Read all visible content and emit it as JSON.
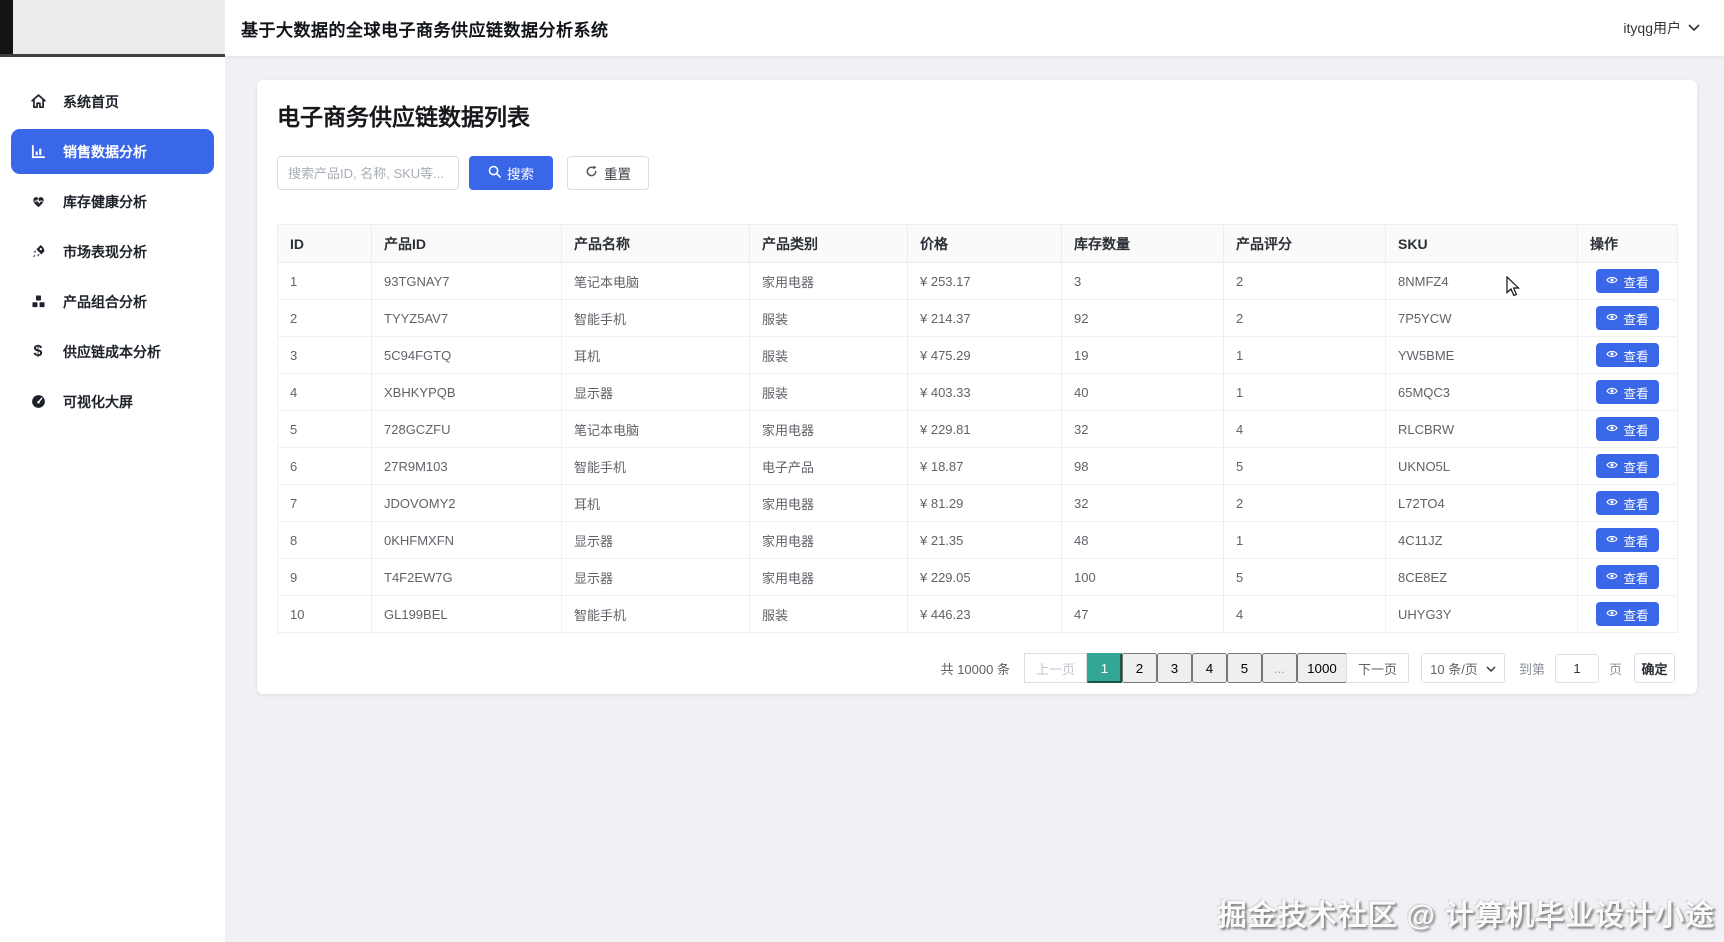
{
  "header": {
    "title": "基于大数据的全球电子商务供应链数据分析系统",
    "user_label": "ityqg用户"
  },
  "sidebar": {
    "items": [
      {
        "label": "系统首页",
        "icon": "home-icon",
        "active": false
      },
      {
        "label": "销售数据分析",
        "icon": "bar-chart-icon",
        "active": true
      },
      {
        "label": "库存健康分析",
        "icon": "heart-pulse-icon",
        "active": false
      },
      {
        "label": "市场表现分析",
        "icon": "rocket-icon",
        "active": false
      },
      {
        "label": "产品组合分析",
        "icon": "boxes-icon",
        "active": false
      },
      {
        "label": "供应链成本分析",
        "icon": "dollar-icon",
        "active": false
      },
      {
        "label": "可视化大屏",
        "icon": "gauge-icon",
        "active": false
      }
    ]
  },
  "main": {
    "card_title": "电子商务供应链数据列表",
    "search": {
      "placeholder": "搜索产品ID, 名称, SKU等...",
      "search_label": "搜索",
      "reset_label": "重置"
    },
    "table": {
      "columns": [
        "ID",
        "产品ID",
        "产品名称",
        "产品类别",
        "价格",
        "库存数量",
        "产品评分",
        "SKU",
        "操作"
      ],
      "action_label": "查看",
      "rows": [
        [
          "1",
          "93TGNAY7",
          "笔记本电脑",
          "家用电器",
          "¥ 253.17",
          "3",
          "2",
          "8NMFZ4"
        ],
        [
          "2",
          "TYYZ5AV7",
          "智能手机",
          "服装",
          "¥ 214.37",
          "92",
          "2",
          "7P5YCW"
        ],
        [
          "3",
          "5C94FGTQ",
          "耳机",
          "服装",
          "¥ 475.29",
          "19",
          "1",
          "YW5BME"
        ],
        [
          "4",
          "XBHKYPQB",
          "显示器",
          "服装",
          "¥ 403.33",
          "40",
          "1",
          "65MQC3"
        ],
        [
          "5",
          "728GCZFU",
          "笔记本电脑",
          "家用电器",
          "¥ 229.81",
          "32",
          "4",
          "RLCBRW"
        ],
        [
          "6",
          "27R9M103",
          "智能手机",
          "电子产品",
          "¥ 18.87",
          "98",
          "5",
          "UKNO5L"
        ],
        [
          "7",
          "JDOVOMY2",
          "耳机",
          "家用电器",
          "¥ 81.29",
          "32",
          "2",
          "L72TO4"
        ],
        [
          "8",
          "0KHFMXFN",
          "显示器",
          "家用电器",
          "¥ 21.35",
          "48",
          "1",
          "4C11JZ"
        ],
        [
          "9",
          "T4F2EW7G",
          "显示器",
          "家用电器",
          "¥ 229.05",
          "100",
          "5",
          "8CE8EZ"
        ],
        [
          "10",
          "GL199BEL",
          "智能手机",
          "服装",
          "¥ 446.23",
          "47",
          "4",
          "UHYG3Y"
        ]
      ]
    },
    "pagination": {
      "total_label": "共 10000 条",
      "prev_label": "上一页",
      "pages": [
        "1",
        "2",
        "3",
        "4",
        "5",
        "...",
        "1000"
      ],
      "active_page": "1",
      "next_label": "下一页",
      "page_size": "10 条/页",
      "goto_prefix": "到第",
      "goto_value": "1",
      "goto_suffix": "页",
      "confirm_label": "确定"
    }
  },
  "watermark": "掘金技术社区 @ 计算机毕业设计小途",
  "colors": {
    "accent_blue": "#3a66e8",
    "active_page_teal": "#33a695",
    "content_bg": "#f0f1f4"
  }
}
